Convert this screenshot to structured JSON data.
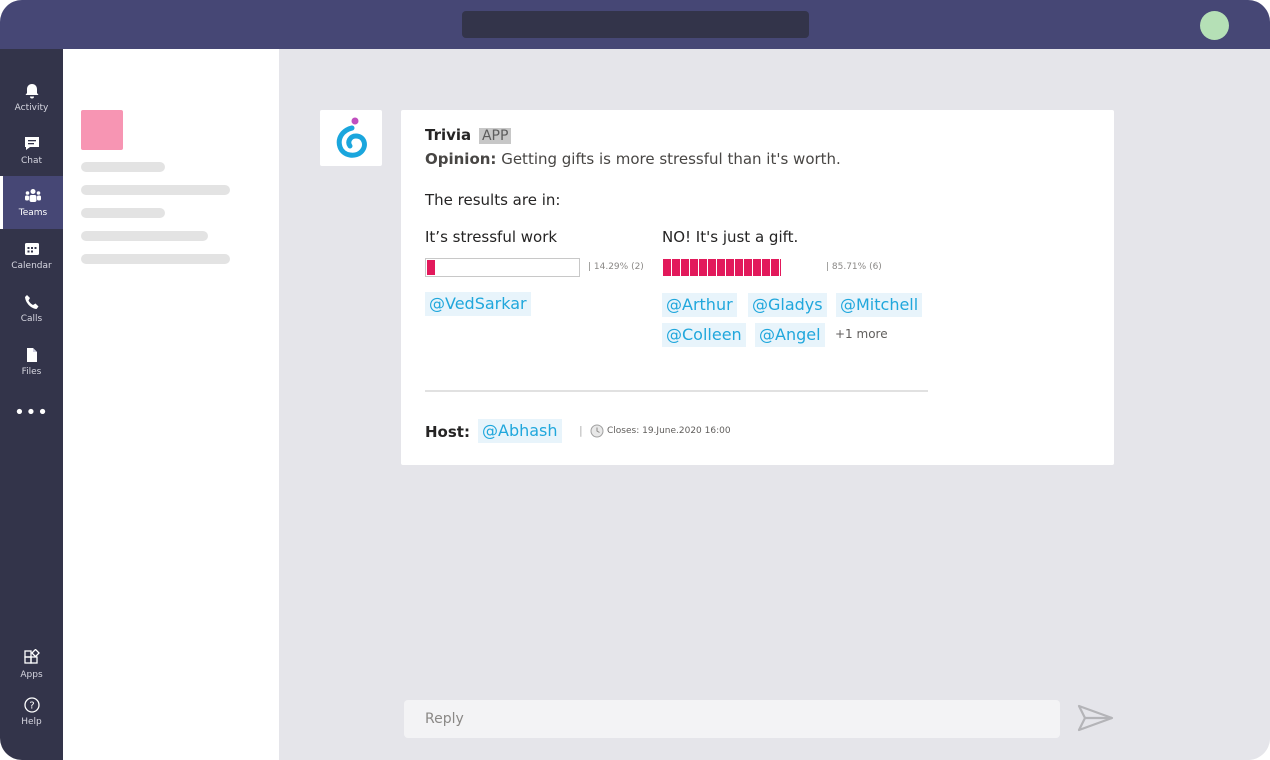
{
  "rail": {
    "items": [
      {
        "label": "Activity"
      },
      {
        "label": "Chat"
      },
      {
        "label": "Teams"
      },
      {
        "label": "Calendar"
      },
      {
        "label": "Calls"
      },
      {
        "label": "Files"
      }
    ],
    "more": "•••",
    "bottom": [
      {
        "label": "Apps"
      },
      {
        "label": "Help"
      }
    ]
  },
  "card": {
    "app_name": "Trivia",
    "app_badge": "APP",
    "opinion_label": "Opinion:",
    "opinion_text": " Getting gifts is more stressful than it's worth.",
    "results_title": "The results are in:",
    "options": [
      {
        "label": "It’s stressful work",
        "stat": "| 14.29% (2)",
        "percent": 14.29,
        "voters": [
          "@VedSarkar"
        ]
      },
      {
        "label": "NO! It's just a gift.",
        "stat": "| 85.71% (6)",
        "percent": 85.71,
        "voters": [
          "@Arthur",
          "@Gladys",
          "@Mitchell",
          "@Colleen",
          "@Angel"
        ],
        "more": "+1 more"
      }
    ],
    "host_label": "Host:",
    "host": "@Abhash",
    "separator": "|",
    "closes": "Closes: 19.June.2020 16:00"
  },
  "composer": {
    "placeholder": "Reply"
  },
  "colors": {
    "titlebar": "#464775",
    "rail": "#33344a",
    "bar": "#e2195b",
    "mention": "#20a7dc",
    "team_avatar": "#f795b3"
  }
}
